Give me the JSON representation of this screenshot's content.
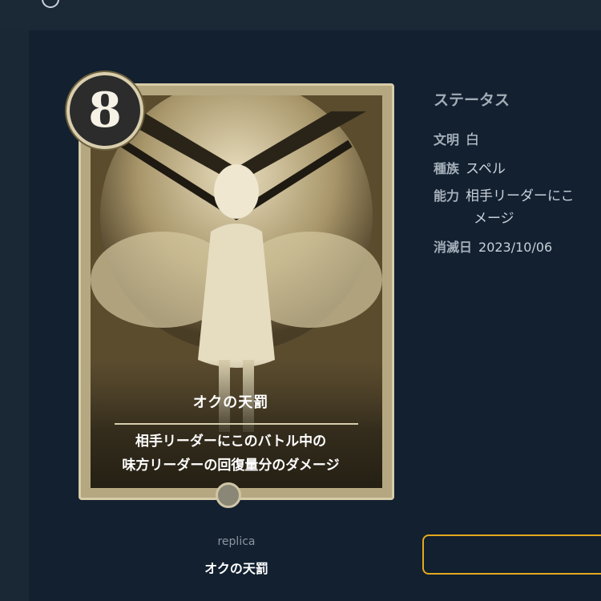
{
  "card": {
    "cost": "8",
    "name": "オクの天罰",
    "effect_line1": "相手リーダーにこのバトル中の",
    "effect_line2": "味方リーダーの回復量分のダメージ"
  },
  "caption": {
    "subtitle": "replica",
    "name": "オクの天罰"
  },
  "status": {
    "title": "ステータス",
    "rows": [
      {
        "key": "文明",
        "value": "白"
      },
      {
        "key": "種族",
        "value": "スペル"
      },
      {
        "key": "能力",
        "value": "相手リーダーにこ",
        "value_cont": "メージ"
      },
      {
        "key": "消滅日",
        "value": "2023/10/06"
      }
    ]
  },
  "colors": {
    "background": "#122030",
    "accent_button_border": "#e3a91e",
    "card_frame": "#b5a881"
  },
  "icons": [
    "app-icon",
    "card-gem-icon"
  ]
}
